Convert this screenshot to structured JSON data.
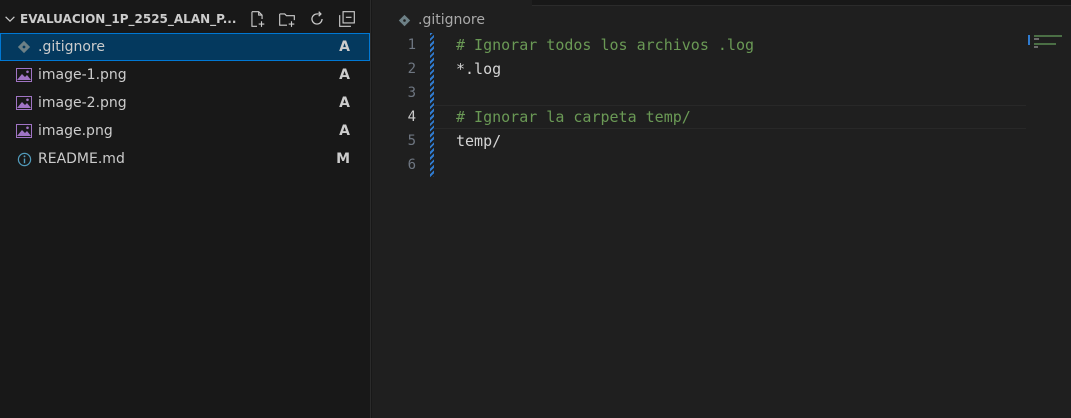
{
  "explorer": {
    "section_title": "EVALUACION_1P_2525_ALAN_P...",
    "actions": [
      "new-file-icon",
      "new-folder-icon",
      "refresh-icon",
      "collapse-all-icon"
    ],
    "files": [
      {
        "name": ".gitignore",
        "status": "A",
        "icon": "gitignore-file-icon",
        "selected": true
      },
      {
        "name": "image-1.png",
        "status": "A",
        "icon": "image-file-icon",
        "selected": false
      },
      {
        "name": "image-2.png",
        "status": "A",
        "icon": "image-file-icon",
        "selected": false
      },
      {
        "name": "image.png",
        "status": "A",
        "icon": "image-file-icon",
        "selected": false
      },
      {
        "name": "README.md",
        "status": "M",
        "icon": "info-file-icon",
        "selected": false
      }
    ]
  },
  "editor": {
    "breadcrumb": ".gitignore",
    "active_line": 4,
    "lines": [
      {
        "num": "1",
        "text": "# Ignorar todos los archivos .log",
        "kind": "comment"
      },
      {
        "num": "2",
        "text": "*.log",
        "kind": "plain"
      },
      {
        "num": "3",
        "text": "",
        "kind": "plain"
      },
      {
        "num": "4",
        "text": "# Ignorar la carpeta temp/",
        "kind": "comment"
      },
      {
        "num": "5",
        "text": "temp/",
        "kind": "plain"
      },
      {
        "num": "6",
        "text": "",
        "kind": "plain"
      }
    ]
  },
  "colors": {
    "selected_row": "#04395e",
    "focus_outline": "#0078d4",
    "comment": "#6a9955",
    "dirty_indicator": "#2f7bd0"
  }
}
